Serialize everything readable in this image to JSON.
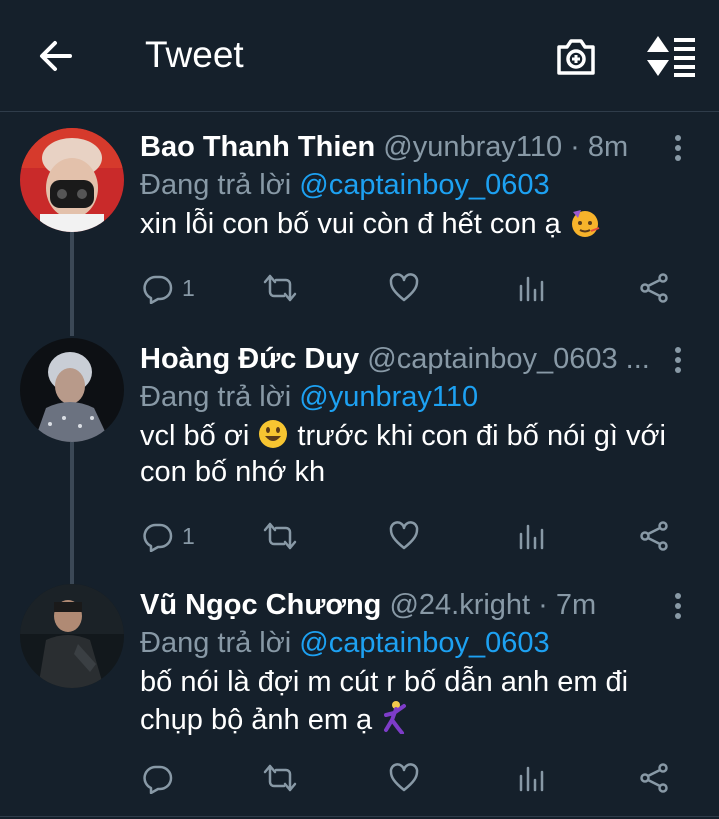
{
  "header": {
    "title": "Tweet"
  },
  "tweets": [
    {
      "name": "Bao Thanh Thien",
      "meta": "@yunbray110 · 8m",
      "reply_prefix": "Đang trả lời",
      "reply_handle": "@captainboy_0603",
      "text": "xin lỗi con bố vui còn đ hết con ạ",
      "emoji": "partying-face-emoji",
      "reply_count": "1"
    },
    {
      "name": "Hoàng Đức Duy",
      "meta": "@captainboy_0603 ...",
      "reply_prefix": "Đang trả lời",
      "reply_handle": "@yunbray110",
      "text_line1_a": "vcl bố ơi",
      "text_line1_b": "trước khi con đi bố nói gì với",
      "text_line2": "con bố nhớ kh",
      "emoji": "smiling-face-emoji",
      "reply_count": "1"
    },
    {
      "name": "Vũ Ngọc Chương",
      "meta": "@24.kright · 7m",
      "reply_prefix": "Đang trả lời",
      "reply_handle": "@captainboy_0603",
      "text_line1": "bố nói là đợi m cút r bố dẫn anh em đi",
      "text_line2": "chụp bộ ảnh em ạ",
      "emoji": "man-dancing-emoji",
      "reply_count": ""
    }
  ],
  "colors": {
    "background": "#15202b",
    "accent": "#1da1f2",
    "muted": "#8899a6",
    "divider": "#2f3c4a"
  }
}
